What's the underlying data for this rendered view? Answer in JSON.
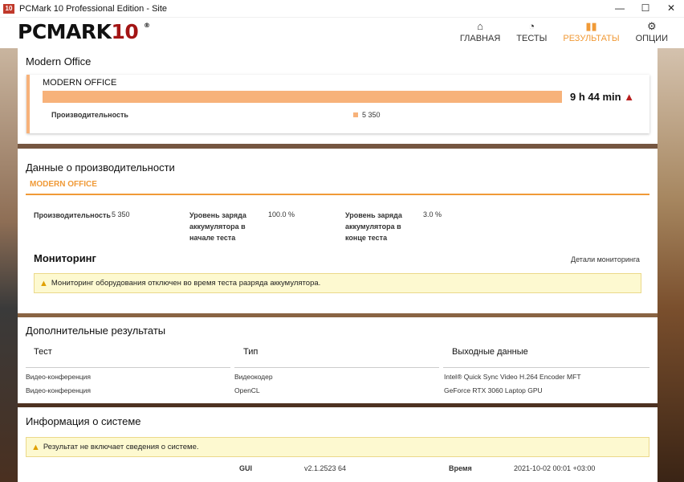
{
  "window": {
    "icon_text": "10",
    "title": "PCMark 10 Professional Edition - Site",
    "controls": {
      "minimize": "—",
      "maximize": "☐",
      "close": "✕"
    }
  },
  "header": {
    "logo_main": "PCMARK",
    "logo_num": "10",
    "logo_reg": "®",
    "nav": [
      {
        "label": "ГЛАВНАЯ",
        "icon": "home-icon",
        "glyph": "⌂",
        "active": false
      },
      {
        "label": "ТЕСТЫ",
        "icon": "gauge-icon",
        "glyph": "◔",
        "active": false
      },
      {
        "label": "РЕЗУЛЬТАТЫ",
        "icon": "bar-chart-icon",
        "glyph": "▮▮",
        "active": true
      },
      {
        "label": "ОПЦИИ",
        "icon": "gear-icon",
        "glyph": "⚙",
        "active": false
      }
    ],
    "accent_color": "#f09a37"
  },
  "modern_office": {
    "section_title": "Modern Office",
    "card_title": "MODERN OFFICE",
    "battery_time": "9 h 44 min",
    "warning_glyph": "▲",
    "perf_label": "Производительность",
    "perf_value": "5 350",
    "bar_color": "#f7b27a"
  },
  "performance_data": {
    "section_title": "Данные о производительности",
    "tab": "MODERN OFFICE",
    "items": [
      {
        "label": "Производительность",
        "value": "5 350"
      },
      {
        "label": "Уровень заряда аккумулятора в начале теста",
        "value": "100.0 %"
      },
      {
        "label": "Уровень заряда аккумулятора в конце теста",
        "value": "3.0 %"
      }
    ],
    "monitoring_title": "Мониторинг",
    "monitoring_link": "Детали мониторинга",
    "monitoring_warning": "Мониторинг оборудования отключен во время теста разряда аккумулятора."
  },
  "additional_results": {
    "section_title": "Дополнительные результаты",
    "columns": [
      "Тест",
      "Тип",
      "Выходные данные"
    ],
    "rows": [
      [
        "Видео-конференция",
        "Видеокодер",
        "Intel® Quick Sync Video H.264 Encoder MFT"
      ],
      [
        "Видео-конференция",
        "OpenCL",
        "GeForce RTX 3060 Laptop GPU"
      ]
    ]
  },
  "system_info": {
    "section_title": "Информация о системе",
    "warning": "Результат не включает сведения о системе.",
    "gui_label": "GUI",
    "gui_value": "v2.1.2523 64",
    "time_label": "Время",
    "time_value": "2021-10-02 00:01 +03:00"
  }
}
